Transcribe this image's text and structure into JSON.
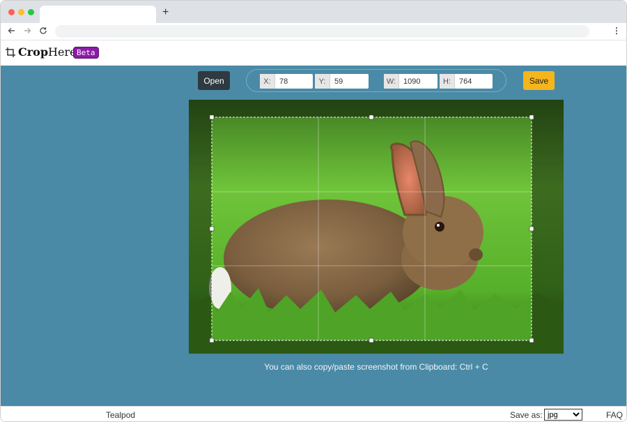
{
  "browser": {
    "new_tab_symbol": "+",
    "menu_symbol": "⋮"
  },
  "app": {
    "name_bold": "Crop",
    "name_regular": "Here",
    "badge": "Beta"
  },
  "toolbar": {
    "open_label": "Open",
    "save_label": "Save",
    "fields": {
      "x_label": "X:",
      "x_value": "78",
      "y_label": "Y:",
      "y_value": "59",
      "w_label": "W:",
      "w_value": "1090",
      "h_label": "H:",
      "h_value": "764"
    }
  },
  "hint_text": "You can also copy/paste screenshot from Clipboard: Ctrl + C",
  "footer": {
    "brand": "Tealpod",
    "save_as_label": "Save as:",
    "format_value": "jpg",
    "faq_label": "FAQ"
  },
  "colors": {
    "canvas_bg": "#4a8aa6",
    "save_button": "#f5b51d",
    "open_button": "#2e3a40",
    "badge": "#8a1ca5"
  },
  "icons": {
    "logo": "crop-icon",
    "back": "arrow-left-icon",
    "forward": "arrow-right-icon",
    "reload": "reload-icon"
  }
}
